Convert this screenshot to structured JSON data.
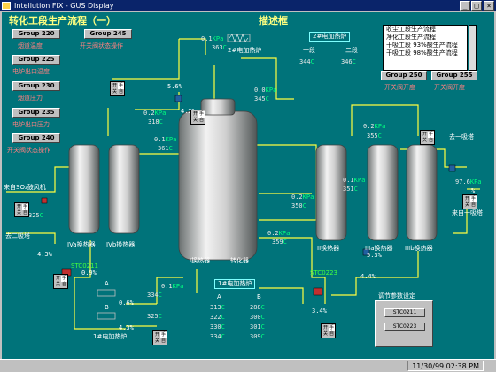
{
  "window": {
    "title": "Intellution FIX - GUS Display",
    "min": "_",
    "max": "□",
    "close": "×"
  },
  "status": {
    "clock": "11/30/99 02:38 PM"
  },
  "screen": {
    "title": "转化工段生产流程（一）",
    "subtitle": "描述框",
    "left_groups": [
      {
        "button": "Group 220",
        "label": "烟道温度"
      },
      {
        "button": "Group 225",
        "label": "电炉出口温度"
      },
      {
        "button": "Group 230",
        "label": "烟道压力"
      },
      {
        "button": "Group 235",
        "label": "电炉出口压力"
      },
      {
        "button": "Group 240",
        "label": "开关阀状态操作"
      }
    ],
    "group245": {
      "button": "Group 245",
      "label": "开关阀状态操作"
    },
    "group250": {
      "button": "Group 250",
      "label": "开关阀开度"
    },
    "group255": {
      "button": "Group 255",
      "label": "开关阀开度"
    },
    "process_list": [
      "收尘工段生产流程",
      "净化工段生产流程",
      "干吸工段 93%酸生产流程",
      "干吸工段 98%酸生产流程"
    ],
    "switch": {
      "open": "开",
      "close": "关",
      "manual": "手",
      "auto": "自"
    },
    "heater2": {
      "title": "2#电加热炉",
      "col1": "一段",
      "col2": "二段",
      "v1": "344",
      "v2": "346"
    },
    "heater1": {
      "title": "1#电加热炉",
      "col1": "A",
      "col2": "B",
      "a": [
        "313",
        "322",
        "330",
        "334"
      ],
      "b": [
        "288",
        "300",
        "301",
        "309"
      ]
    },
    "temp_unit": "C",
    "pressure_unit": "KPa",
    "readings": {
      "p_top_center": "0.1",
      "t_top_center": "363",
      "p_right_center": "0.0",
      "t_right_center": "345",
      "p_left_mid": "0.2",
      "t_left_mid": "318",
      "p_left_low": "0.1",
      "t_left_low": "361",
      "p_right_mid": "0.2",
      "t_right_mid": "355",
      "p_right_low": "0.1",
      "t_right_low": "351",
      "p_right_lower": "0.2",
      "t_right_lower": "350",
      "p_bottom_center": "0.2",
      "t_bottom_center": "359",
      "t_left_exch": "325",
      "p_bottom_left": "0.1",
      "t_bottom_left_a": "334",
      "t_bottom_left_b": "325",
      "p_right_edge": "97.6"
    },
    "percents": {
      "pct_top": "5.6%",
      "pct_top2": "4.2%",
      "pct_left_a": "4.3%",
      "pct_left_b": "0.9%",
      "pct_a": "0.6%",
      "pct_b": "4.3%",
      "pct_mid": "5.3%",
      "pct_right": "4.4%",
      "pct_right2": "3.4%",
      "pct_right_edge": "%"
    },
    "labels": {
      "so2_in": "来自SO₂鼓风机",
      "to_tower2": "去二吸塔",
      "to_tower1": "去一吸塔",
      "from_tower1": "来自一吸塔",
      "exch_iva": "IVa换热器",
      "exch_ivb": "IVb换热器",
      "exch1": "I换热器",
      "converter": "转化器",
      "exch2": "II换热器",
      "exch3a": "IIIa换热器",
      "exch3b": "IIIb换热器",
      "heater1_bottom": "1#电加热炉",
      "valve_a": "A",
      "valve_b": "B",
      "stc_left": "STC0211",
      "stc_right": "STC0223"
    },
    "param": {
      "title": "调节参数设定",
      "btn1": "STC0211",
      "btn2": "STC0223"
    }
  }
}
